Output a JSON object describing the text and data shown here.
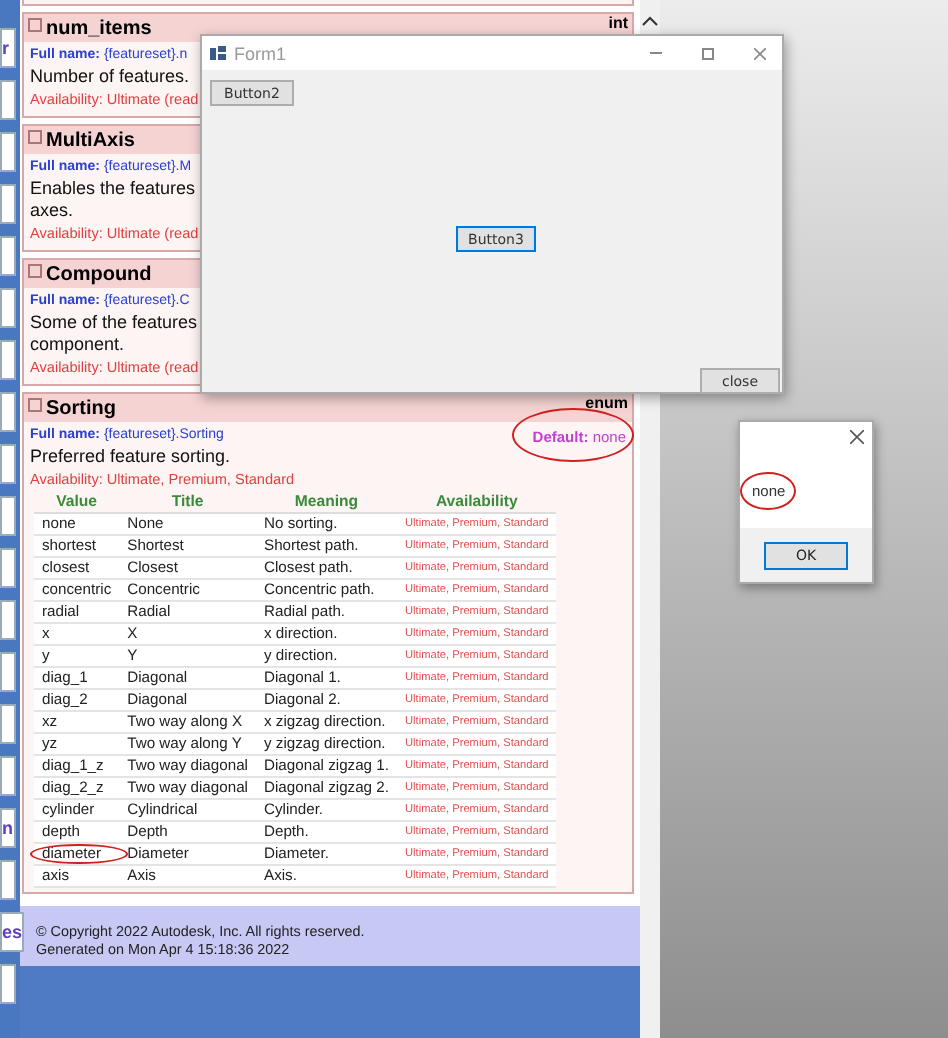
{
  "sidebar": {
    "items": [
      {
        "label": "r"
      },
      {
        "label": "n"
      },
      {
        "label": "es"
      }
    ]
  },
  "properties": [
    {
      "name": "num_items",
      "type": "int",
      "full_name_label": "Full name:",
      "full_name": "{featureset}.n",
      "description": [
        "Number of features."
      ],
      "availability": "Availability: Ultimate (read"
    },
    {
      "name": "MultiAxis",
      "full_name_label": "Full name:",
      "full_name": "{featureset}.M",
      "description": [
        "Enables the features",
        "axes."
      ],
      "availability": "Availability: Ultimate (read"
    },
    {
      "name": "Compound",
      "full_name_label": "Full name:",
      "full_name": "{featureset}.C",
      "description": [
        "Some of the features",
        "component."
      ],
      "availability": "Availability: Ultimate (read"
    },
    {
      "name": "Sorting",
      "type": "enum",
      "full_name_label": "Full name:",
      "full_name": "{featureset}.Sorting",
      "default_label": "Default:",
      "default_value": "none",
      "description": [
        "Preferred feature sorting."
      ],
      "availability": "Availability: Ultimate, Premium, Standard",
      "table": {
        "columns": [
          "Value",
          "Title",
          "Meaning",
          "Availability"
        ],
        "rows": [
          [
            "none",
            "None",
            "No sorting.",
            "Ultimate, Premium, Standard"
          ],
          [
            "shortest",
            "Shortest",
            "Shortest path.",
            "Ultimate, Premium, Standard"
          ],
          [
            "closest",
            "Closest",
            "Closest path.",
            "Ultimate, Premium, Standard"
          ],
          [
            "concentric",
            "Concentric",
            "Concentric path.",
            "Ultimate, Premium, Standard"
          ],
          [
            "radial",
            "Radial",
            "Radial path.",
            "Ultimate, Premium, Standard"
          ],
          [
            "x",
            "X",
            "x direction.",
            "Ultimate, Premium, Standard"
          ],
          [
            "y",
            "Y",
            "y direction.",
            "Ultimate, Premium, Standard"
          ],
          [
            "diag_1",
            "Diagonal",
            "Diagonal 1.",
            "Ultimate, Premium, Standard"
          ],
          [
            "diag_2",
            "Diagonal",
            "Diagonal 2.",
            "Ultimate, Premium, Standard"
          ],
          [
            "xz",
            "Two way along X",
            "x zigzag direction.",
            "Ultimate, Premium, Standard"
          ],
          [
            "yz",
            "Two way along Y",
            "y zigzag direction.",
            "Ultimate, Premium, Standard"
          ],
          [
            "diag_1_z",
            "Two way diagonal",
            "Diagonal zigzag 1.",
            "Ultimate, Premium, Standard"
          ],
          [
            "diag_2_z",
            "Two way diagonal",
            "Diagonal zigzag 2.",
            "Ultimate, Premium, Standard"
          ],
          [
            "cylinder",
            "Cylindrical",
            "Cylinder.",
            "Ultimate, Premium, Standard"
          ],
          [
            "depth",
            "Depth",
            "Depth.",
            "Ultimate, Premium, Standard"
          ],
          [
            "diameter",
            "Diameter",
            "Diameter.",
            "Ultimate, Premium, Standard"
          ],
          [
            "axis",
            "Axis",
            "Axis.",
            "Ultimate, Premium, Standard"
          ]
        ]
      }
    }
  ],
  "footer": {
    "lines": [
      "© Copyright 2022 Autodesk, Inc. All rights reserved.",
      "Generated on Mon Apr 4 15:18:36 2022"
    ]
  },
  "form_window": {
    "title": "Form1",
    "buttons": [
      {
        "label": "Button2",
        "focused": false
      },
      {
        "label": "Button3",
        "focused": true
      },
      {
        "label": "close",
        "focused": false
      }
    ]
  },
  "message_box": {
    "text": "none",
    "button": "OK"
  }
}
